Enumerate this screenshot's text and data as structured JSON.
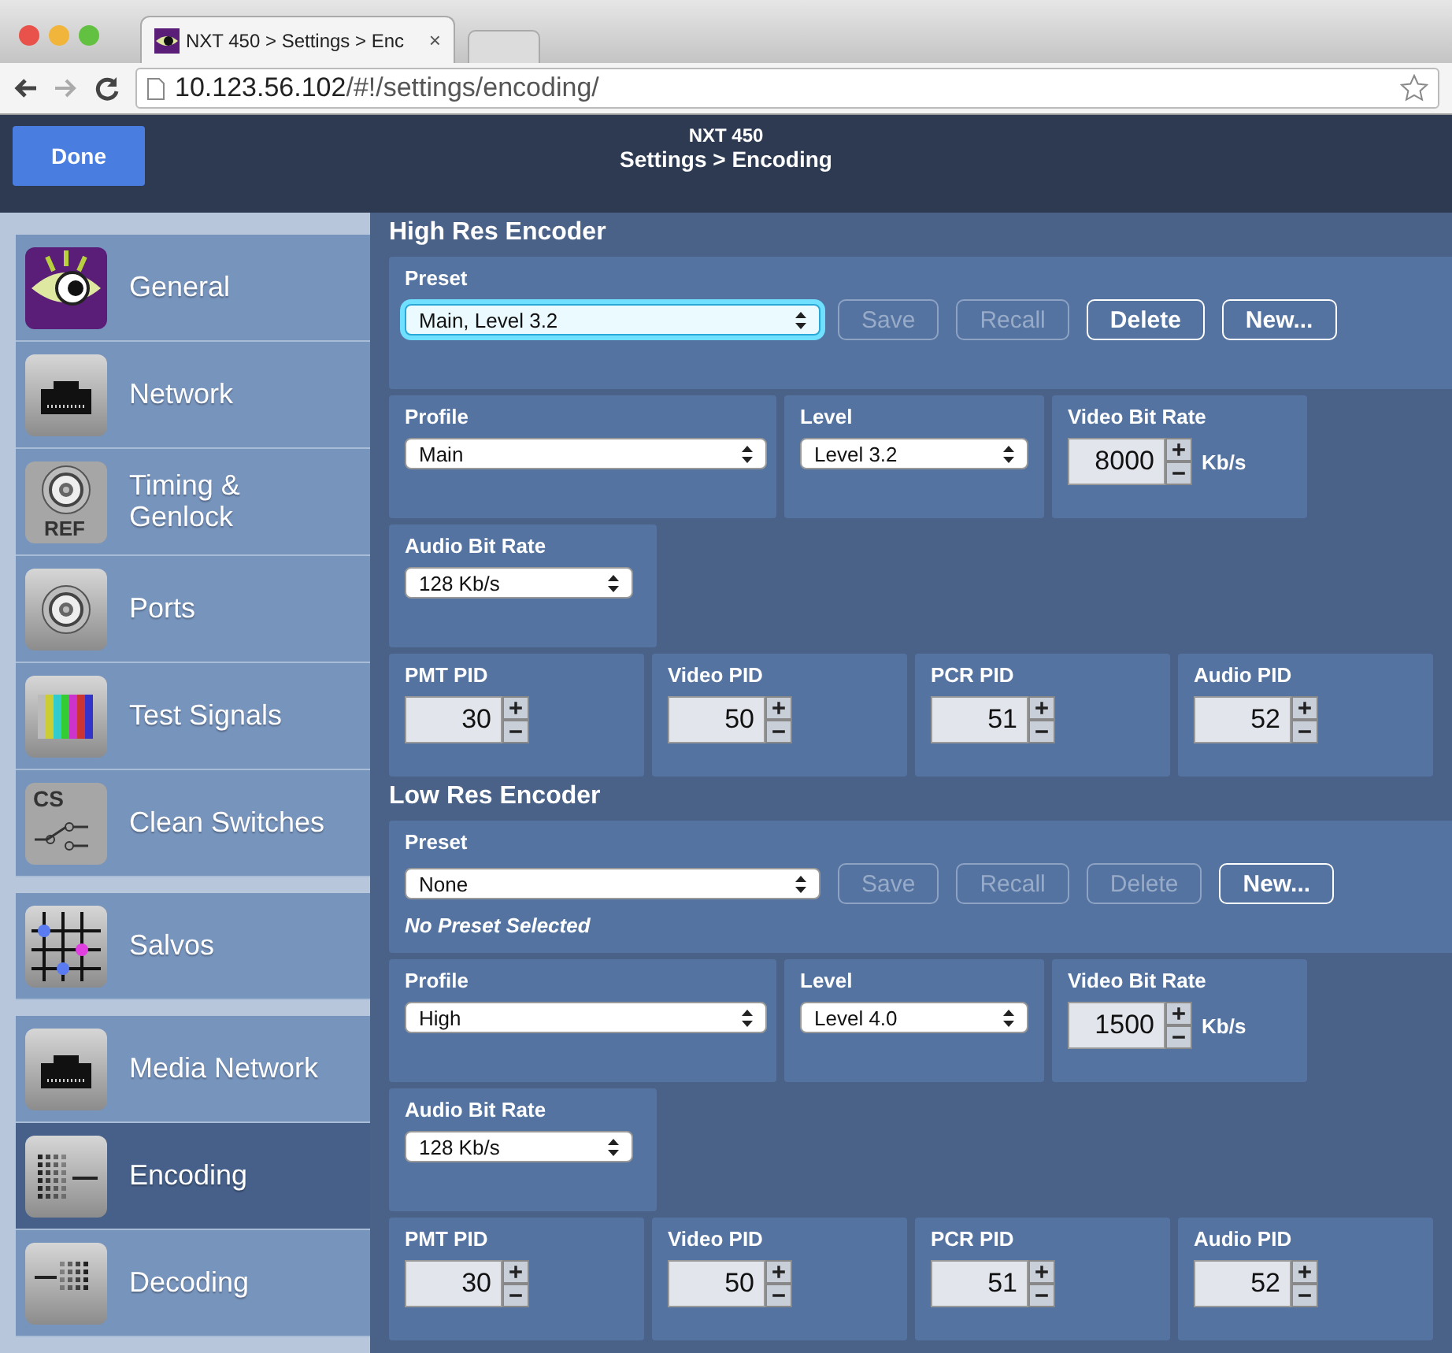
{
  "browser": {
    "tab": {
      "title": "NXT 450 > Settings > Enc",
      "close": "×"
    },
    "address": {
      "host": "10.123.56.102",
      "path": "/#!/settings/encoding/"
    }
  },
  "header": {
    "done": "Done",
    "device": "NXT 450",
    "title": "Settings > Encoding"
  },
  "sidebar": {
    "groups": [
      {
        "items": [
          {
            "label": "General",
            "selected": false
          },
          {
            "label": "Network",
            "selected": false
          },
          {
            "label": "Timing & Genlock",
            "badge": "REF",
            "selected": false
          },
          {
            "label": "Ports",
            "selected": false
          },
          {
            "label": "Test Signals",
            "selected": false
          },
          {
            "label": "Clean Switches",
            "badge": "CS",
            "selected": false
          }
        ]
      },
      {
        "items": [
          {
            "label": "Salvos",
            "selected": false
          }
        ]
      },
      {
        "items": [
          {
            "label": "Media Network",
            "selected": false
          },
          {
            "label": "Encoding",
            "selected": true
          },
          {
            "label": "Decoding",
            "selected": false
          }
        ]
      }
    ]
  },
  "sections": [
    {
      "title": "High Res Encoder",
      "preset": {
        "label": "Preset",
        "value": "Main, Level 3.2",
        "focused": true
      },
      "buttons": [
        {
          "label": "Save",
          "disabled": true
        },
        {
          "label": "Recall",
          "disabled": true
        },
        {
          "label": "Delete",
          "disabled": false
        },
        {
          "label": "New...",
          "disabled": false
        }
      ],
      "rows": [
        [
          {
            "kind": "select",
            "label": "Profile",
            "value": "Main"
          },
          {
            "kind": "select",
            "label": "Level",
            "value": "Level 3.2"
          },
          {
            "kind": "spinner",
            "label": "Video Bit Rate",
            "value": "8000",
            "unit": "Kb/s"
          }
        ],
        [
          {
            "kind": "select",
            "label": "Audio Bit Rate",
            "value": "128 Kb/s"
          }
        ],
        [
          {
            "kind": "spinner",
            "label": "PMT PID",
            "value": "30"
          },
          {
            "kind": "spinner",
            "label": "Video PID",
            "value": "50"
          },
          {
            "kind": "spinner",
            "label": "PCR PID",
            "value": "51"
          },
          {
            "kind": "spinner",
            "label": "Audio PID",
            "value": "52"
          }
        ]
      ]
    },
    {
      "title": "Low Res Encoder",
      "preset": {
        "label": "Preset",
        "value": "None",
        "focused": false,
        "note": "No Preset Selected"
      },
      "buttons": [
        {
          "label": "Save",
          "disabled": true
        },
        {
          "label": "Recall",
          "disabled": true
        },
        {
          "label": "Delete",
          "disabled": true
        },
        {
          "label": "New...",
          "disabled": false
        }
      ],
      "rows": [
        [
          {
            "kind": "select",
            "label": "Profile",
            "value": "High"
          },
          {
            "kind": "select",
            "label": "Level",
            "value": "Level 4.0"
          },
          {
            "kind": "spinner",
            "label": "Video Bit Rate",
            "value": "1500",
            "unit": "Kb/s"
          }
        ],
        [
          {
            "kind": "select",
            "label": "Audio Bit Rate",
            "value": "128 Kb/s"
          }
        ],
        [
          {
            "kind": "spinner",
            "label": "PMT PID",
            "value": "30"
          },
          {
            "kind": "spinner",
            "label": "Video PID",
            "value": "50"
          },
          {
            "kind": "spinner",
            "label": "PCR PID",
            "value": "51"
          },
          {
            "kind": "spinner",
            "label": "Audio PID",
            "value": "52"
          }
        ]
      ]
    }
  ]
}
